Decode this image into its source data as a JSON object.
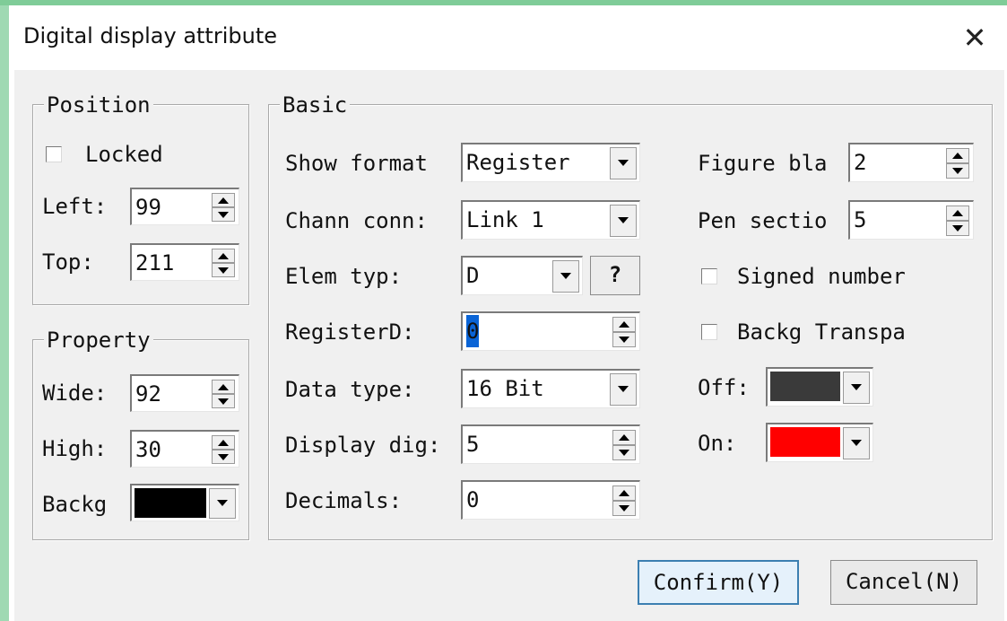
{
  "window": {
    "title": "Digital display attribute",
    "close_glyph": "✕"
  },
  "position": {
    "label": "Position",
    "locked_label": "Locked",
    "locked": false,
    "left_label": "Left:",
    "left_value": "99",
    "top_label": "Top:",
    "top_value": "211"
  },
  "property": {
    "label": "Property",
    "wide_label": "Wide:",
    "wide_value": "92",
    "high_label": "High:",
    "high_value": "30",
    "backg_label": "Backg",
    "backg_color": "#000000"
  },
  "basic": {
    "label": "Basic",
    "show_format_label": "Show format",
    "show_format_value": "Register",
    "chann_conn_label": "Chann conn:",
    "chann_conn_value": "Link 1",
    "elem_typ_label": "Elem typ:",
    "elem_typ_value": "D",
    "help_label": "?",
    "register_label": "RegisterD:",
    "register_value": "0",
    "data_type_label": "Data type:",
    "data_type_value": "16 Bit",
    "display_dig_label": "Display dig:",
    "display_dig_value": "5",
    "decimals_label": "Decimals:",
    "decimals_value": "0",
    "figure_bla_label": "Figure bla",
    "figure_bla_value": "2",
    "pen_section_label": "Pen sectio",
    "pen_section_value": "5",
    "signed_label": "Signed number",
    "signed": false,
    "backg_transpa_label": "Backg Transpa",
    "backg_transpa": false,
    "off_label": "Off:",
    "off_color": "#3a3a3a",
    "on_label": "On:",
    "on_color": "#ff0000"
  },
  "buttons": {
    "confirm": "Confirm(Y)",
    "cancel": "Cancel(N)"
  }
}
